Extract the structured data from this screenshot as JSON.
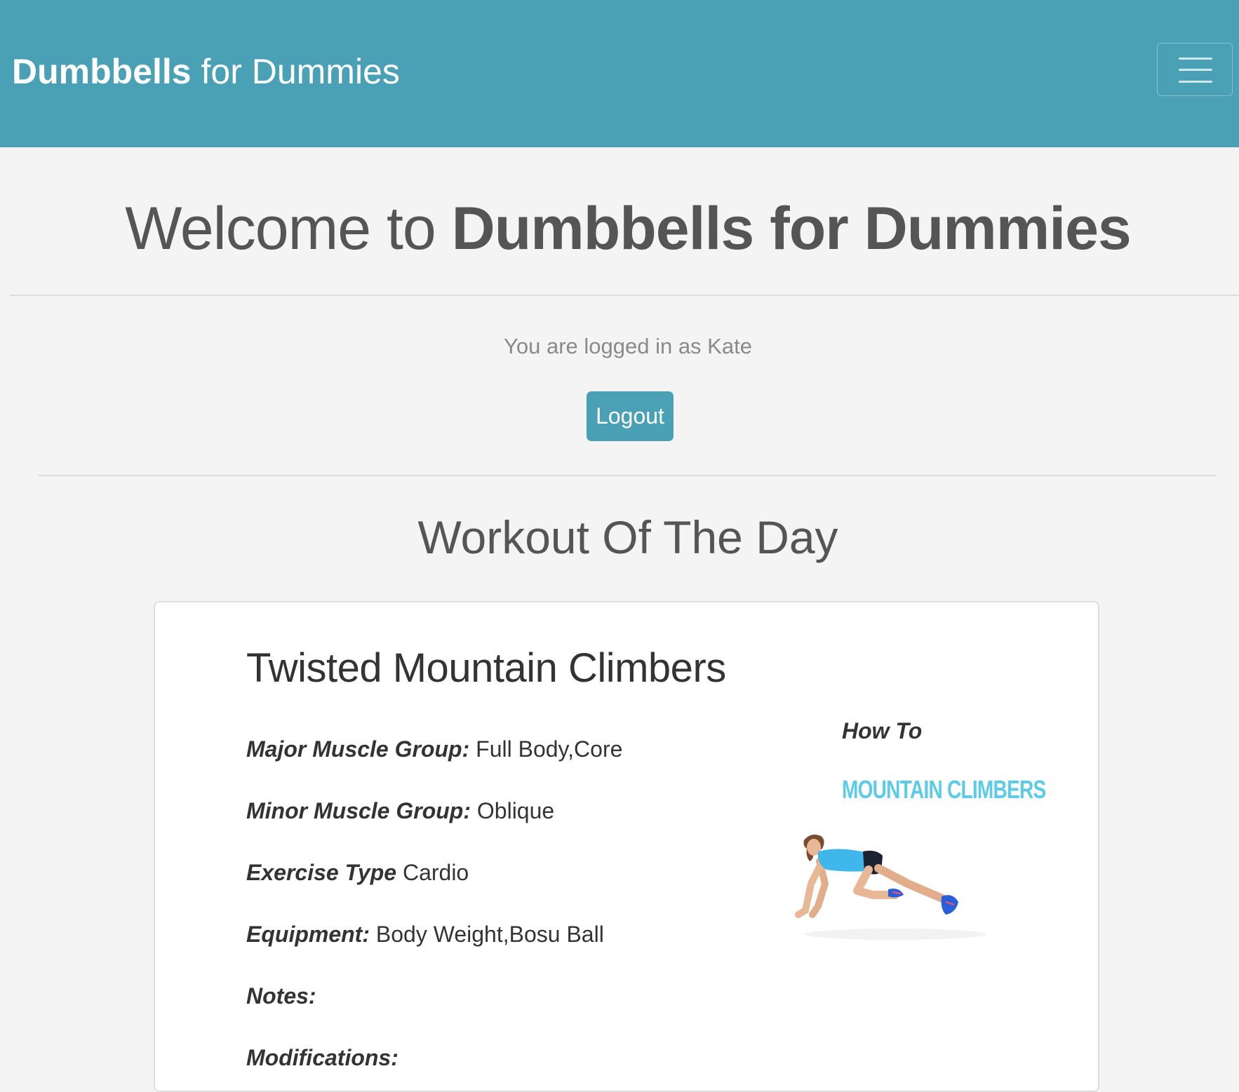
{
  "navbar": {
    "brand_bold": "Dumbbells",
    "brand_light": "for Dummies",
    "menu_icon": "hamburger-menu-icon"
  },
  "welcome": {
    "prefix": "Welcome to",
    "name": "Dumbbells for Dummies"
  },
  "session": {
    "logged_in_text": "You are logged in as Kate",
    "logout_label": "Logout"
  },
  "workout": {
    "section_title": "Workout Of The Day",
    "exercise_name": "Twisted Mountain Climbers",
    "details": {
      "major_label": "Major Muscle Group:",
      "major_value": "Full Body,Core",
      "minor_label": "Minor Muscle Group:",
      "minor_value": "Oblique",
      "type_label": "Exercise Type",
      "type_value": "Cardio",
      "equipment_label": "Equipment:",
      "equipment_value": "Body Weight,Bosu Ball",
      "notes_label": "Notes:",
      "notes_value": "",
      "modifications_label": "Modifications:",
      "modifications_value": ""
    },
    "howto": {
      "label": "How To",
      "subtitle": "MOUNTAIN CLIMBERS"
    }
  },
  "colors": {
    "primary": "#4aa0b5",
    "background": "#f4f4f4",
    "heading": "#555555",
    "howto_accent": "#5ccbe8"
  }
}
